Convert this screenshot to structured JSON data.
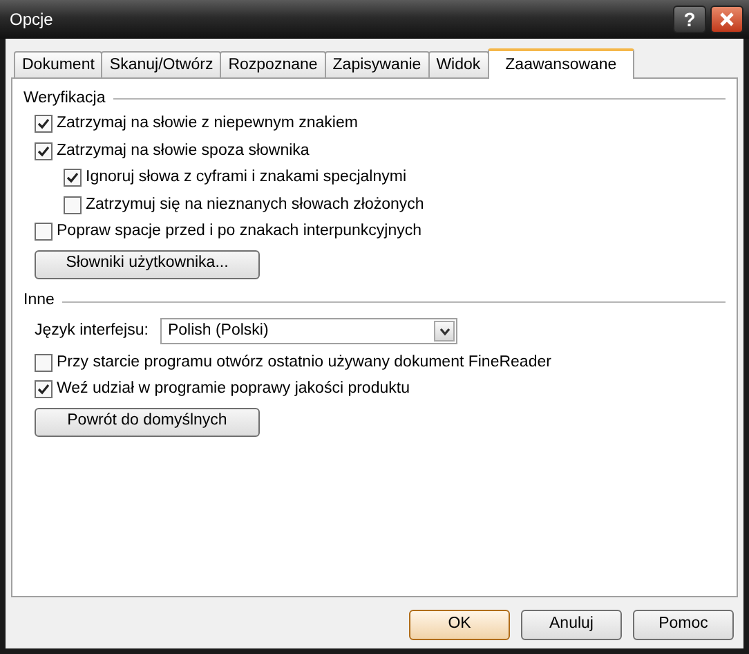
{
  "window": {
    "title": "Opcje",
    "help_button": "?"
  },
  "tabs": [
    {
      "label": "Dokument",
      "selected": false
    },
    {
      "label": "Skanuj/Otwórz",
      "selected": false
    },
    {
      "label": "Rozpoznane",
      "selected": false
    },
    {
      "label": "Zapisywanie",
      "selected": false
    },
    {
      "label": "Widok",
      "selected": false
    },
    {
      "label": "Zaawansowane",
      "selected": true
    }
  ],
  "sections": [
    {
      "title": "Weryfikacja",
      "items": [
        {
          "kind": "checkbox",
          "label": "Zatrzymaj na słowie z niepewnym znakiem",
          "checked": true
        },
        {
          "kind": "checkbox",
          "label": "Zatrzymaj na słowie spoza słownika",
          "checked": true,
          "children": [
            {
              "kind": "checkbox",
              "label": "Ignoruj słowa z cyframi i znakami specjalnymi",
              "checked": true
            },
            {
              "kind": "checkbox",
              "label": "Zatrzymuj się na nieznanych słowach złożonych",
              "checked": false
            }
          ]
        },
        {
          "kind": "checkbox",
          "label": "Popraw spacje przed i po znakach interpunkcyjnych",
          "checked": false
        },
        {
          "kind": "button",
          "label": "Słowniki użytkownika..."
        }
      ]
    },
    {
      "title": "Inne",
      "items": [
        {
          "kind": "select",
          "label": "Język interfejsu:",
          "value": "Polish (Polski)"
        },
        {
          "kind": "checkbox",
          "label": "Przy starcie programu otwórz ostatnio używany dokument FineReader",
          "checked": false
        },
        {
          "kind": "checkbox",
          "label": "Weź udział w programie poprawy jakości produktu",
          "checked": true
        },
        {
          "kind": "button",
          "label": "Powrót do domyślnych"
        }
      ]
    }
  ],
  "buttons": [
    {
      "label": "OK",
      "default": true
    },
    {
      "label": "Anuluj",
      "default": false
    },
    {
      "label": "Pomoc",
      "default": false
    }
  ]
}
